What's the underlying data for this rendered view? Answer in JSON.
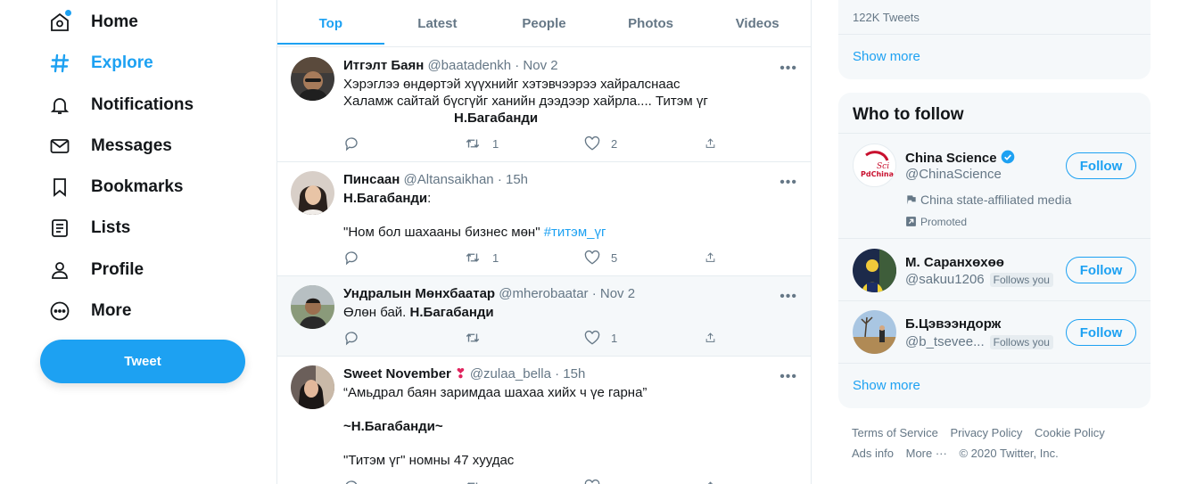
{
  "nav": {
    "home": "Home",
    "explore": "Explore",
    "notifications": "Notifications",
    "messages": "Messages",
    "bookmarks": "Bookmarks",
    "lists": "Lists",
    "profile": "Profile",
    "more": "More",
    "tweet_button": "Tweet",
    "accent_color": "#1da1f2"
  },
  "tabs": [
    "Top",
    "Latest",
    "People",
    "Photos",
    "Videos"
  ],
  "tweets": [
    {
      "name": "Итгэлт Баян",
      "handle": "@baatadenkh",
      "time": "Nov 2",
      "line1": "Хэрэглээ өндөртэй хүүхнийг хэтэвчээрээ хайралснаас",
      "line2": "Халамж сайтай бүсгүйг ханийн дээдээр хайрла.... Титэм үг",
      "line3": "Н.Багабанди",
      "retweets": "1",
      "likes": "2"
    },
    {
      "name": "Пинсаан",
      "handle": "@Altansaikhan",
      "time": "15h",
      "line1": "Н.Багабанди",
      "line1_suffix": ":",
      "quote": "\"Ном бол шахааны бизнес мөн\"",
      "hashtag": "#титэм_үг",
      "retweets": "1",
      "likes": "5"
    },
    {
      "name": "Ундралын Мөнхбаатар",
      "handle": "@mherobaatar",
      "time": "Nov 2",
      "line1": "Өлөн бай.",
      "line1_bold": "Н.Багабанди",
      "likes": "1"
    },
    {
      "name": "Sweet November",
      "emoji": "❣",
      "handle": "@zulaa_bella",
      "time": "15h",
      "line1": "“Амьдрал баян заримдаа шахаа хийх ч үе гарна”",
      "line2": "~Н.Багабанди~",
      "line3": "\"Титэм үг\" номны 47 хуудас"
    }
  ],
  "trends": {
    "count": "122K Tweets",
    "show_more": "Show more"
  },
  "who_to_follow": {
    "title": "Who to follow",
    "show_more": "Show more",
    "follow_label": "Follow",
    "users": [
      {
        "name": "China Science",
        "handle": "@ChinaScience",
        "affiliation": "China state-affiliated media",
        "promoted": "Promoted",
        "avatar_text_1": "Sci",
        "avatar_text_2": "PdChina"
      },
      {
        "name": "М. Саранхөхөө",
        "handle": "@sakuu1206",
        "follows_you": "Follows you"
      },
      {
        "name": "Б.Цэвээндорж",
        "handle": "@b_tsevee...",
        "follows_you": "Follows you"
      }
    ]
  },
  "footer": {
    "terms": "Terms of Service",
    "privacy": "Privacy Policy",
    "cookie": "Cookie Policy",
    "ads": "Ads info",
    "more": "More ···",
    "copyright": "© 2020 Twitter, Inc."
  }
}
